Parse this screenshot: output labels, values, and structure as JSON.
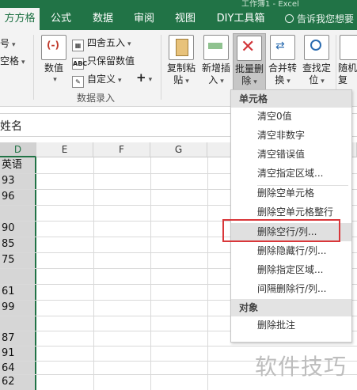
{
  "title_partial": "工作簿1 - Excel",
  "tabs": [
    {
      "label": "方方格子",
      "active": true
    },
    {
      "label": "公式",
      "active": false
    },
    {
      "label": "数据",
      "active": false
    },
    {
      "label": "审阅",
      "active": false
    },
    {
      "label": "视图",
      "active": false
    },
    {
      "label": "DIY工具箱",
      "active": false
    }
  ],
  "tell_me": "告诉我您想要",
  "ribbon": {
    "left_partial_1": "号",
    "left_partial_2": "空格",
    "numeric_label": "数值",
    "round_label": "四舍五入",
    "keep_numeric_label": "只保留数值",
    "custom_label": "自定义",
    "plus": "+",
    "group_label": "数据录入",
    "copy_paste": [
      "复制粘",
      "贴"
    ],
    "new_insert": [
      "新增插",
      "入"
    ],
    "batch_delete": [
      "批量删",
      "除"
    ],
    "merge_convert": [
      "合并转",
      "换"
    ],
    "find_locate": [
      "查找定",
      "位"
    ],
    "random_partial": [
      "随机",
      "复"
    ]
  },
  "formula_bar": {
    "name_partial": "姓名"
  },
  "grid": {
    "columns": [
      {
        "label": "D",
        "selected": true
      },
      {
        "label": "E",
        "selected": false
      },
      {
        "label": "F",
        "selected": false
      },
      {
        "label": "G",
        "selected": false
      }
    ],
    "column_d_cells": [
      "英语",
      "93",
      "96",
      "",
      "90",
      "85",
      "75",
      "",
      "61",
      "99",
      "",
      "87",
      "91",
      "64",
      "62"
    ]
  },
  "menu": {
    "section1": "单元格",
    "items1": [
      "清空0值",
      "清空非数字",
      "清空错误值",
      "清空指定区域...",
      "删除空单元格",
      "删除空单元格整行",
      "删除空行/列...",
      "删除隐藏行/列...",
      "删除指定区域...",
      "间隔删除行/列..."
    ],
    "highlighted_index": 6,
    "section2": "对象",
    "items2": [
      "删除批注"
    ]
  },
  "watermark": "软件技巧",
  "colors": {
    "excel_green": "#217346",
    "highlight_red": "#d9373a"
  }
}
